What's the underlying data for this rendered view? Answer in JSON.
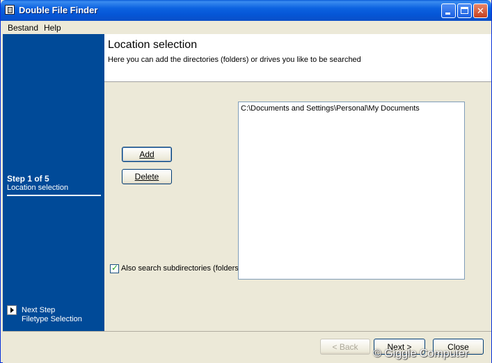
{
  "window": {
    "title": "Double File Finder"
  },
  "menubar": {
    "items": [
      {
        "label": "Bestand"
      },
      {
        "label": "Help"
      }
    ]
  },
  "sidebar": {
    "step_title": "Step 1 of 5",
    "step_subtitle": "Location selection",
    "next_step_label": "Next Step",
    "next_step_name": "Filetype Selection"
  },
  "header": {
    "title": "Location selection",
    "subtitle": "Here you can add the directories (folders) or drives you like to be searched"
  },
  "content": {
    "add_button": "Add",
    "delete_button": "Delete",
    "subdirs_checkbox": {
      "label": "Also search subdirectories (folders)",
      "checked": true
    },
    "locations": [
      "C:\\Documents and Settings\\Personal\\My Documents"
    ]
  },
  "footer": {
    "back_button": "< Back",
    "next_button": "Next >",
    "close_button": "Close"
  },
  "watermark": "© Giggle Computer",
  "icons": {
    "app": "app-icon",
    "minimize": "minimize-icon",
    "maximize": "maximize-icon",
    "close": "close-icon",
    "next_step": "play-arrow-icon",
    "check": "checkmark-icon"
  },
  "colors": {
    "sidebar": "#004a98",
    "titlebar": "#0a5bd8",
    "check": "#21a121"
  }
}
